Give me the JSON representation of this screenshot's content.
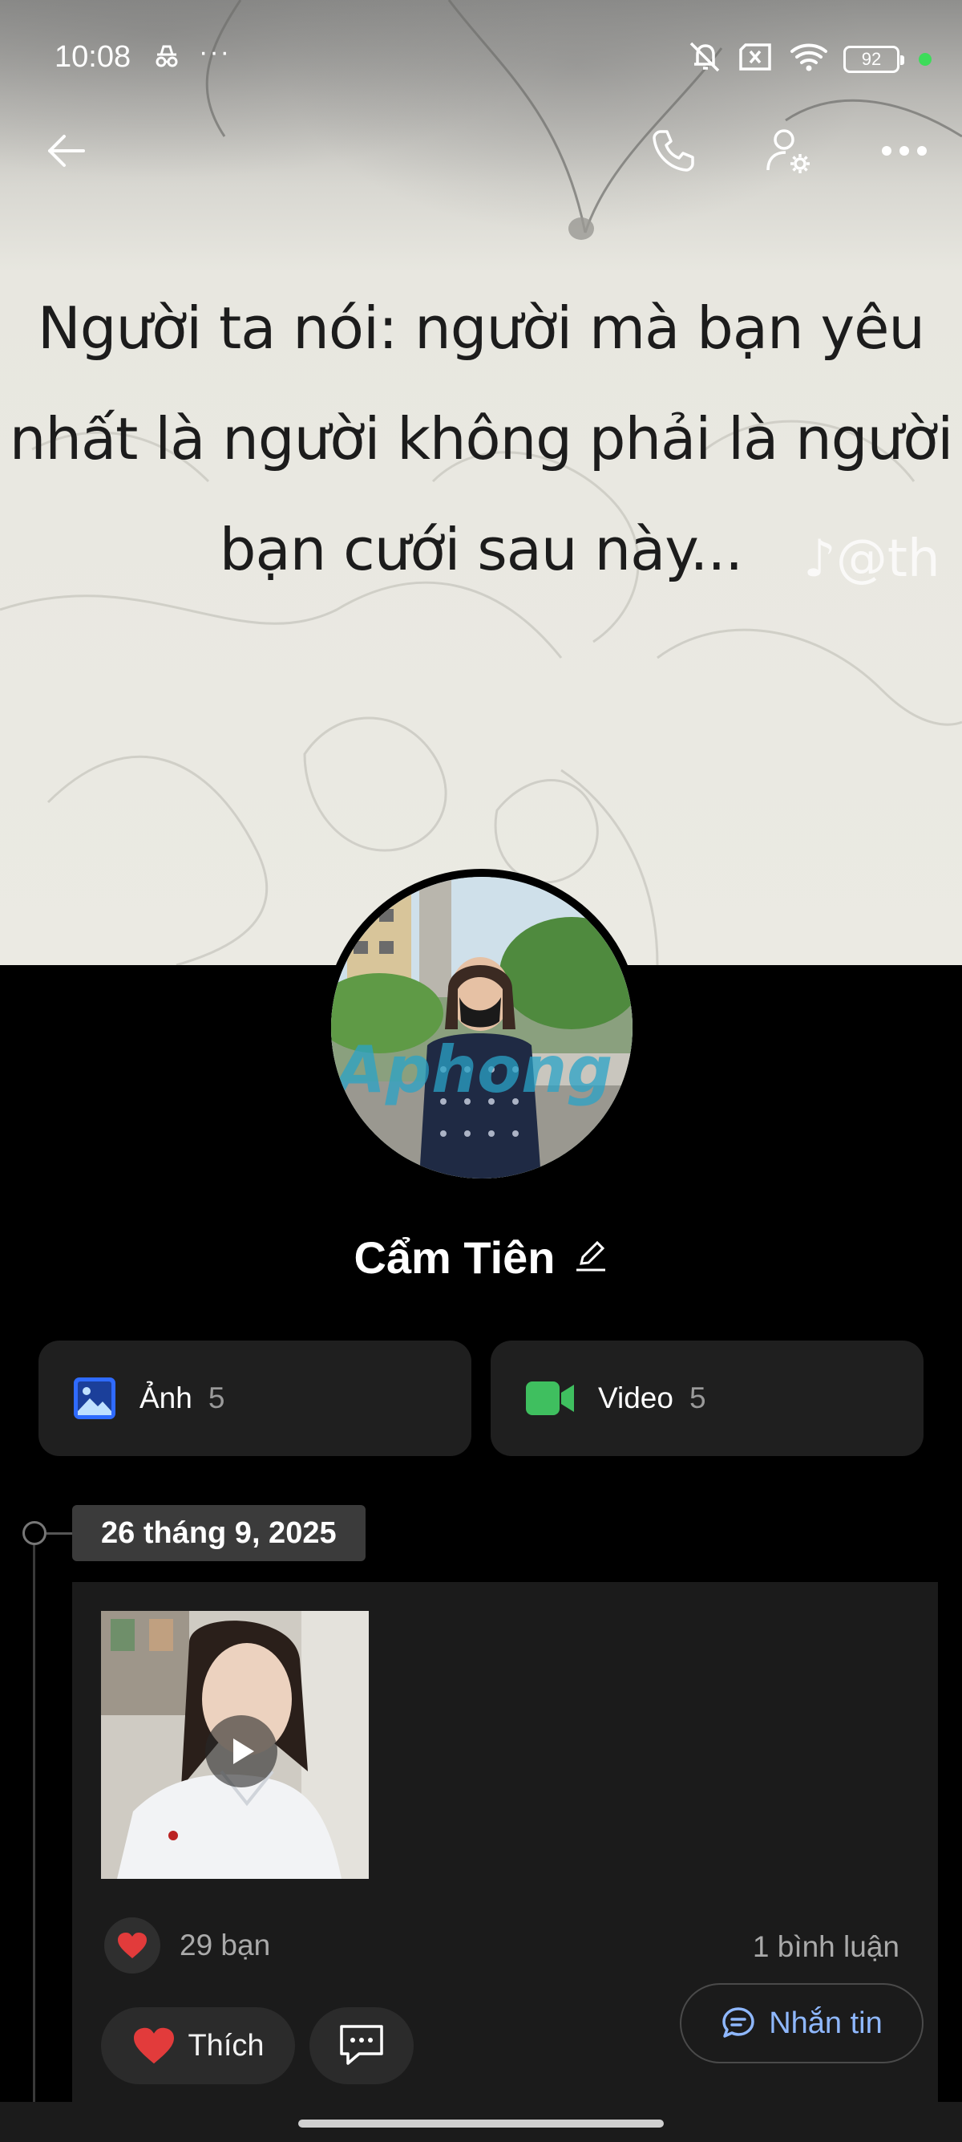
{
  "status_bar": {
    "time": "10:08",
    "battery": "92",
    "icons": [
      "incognito-icon",
      "more-dots-icon",
      "mute-icon",
      "no-sim-icon",
      "wifi-icon",
      "battery-icon"
    ]
  },
  "cover": {
    "quote_lines": [
      "Người ta nói: người mà bạn yêu",
      "nhất là người không phải là người",
      "bạn cưới sau này..."
    ],
    "watermark": "♪@th"
  },
  "header": {
    "icons": [
      "back-arrow-icon",
      "phone-icon",
      "profile-settings-icon",
      "more-horizontal-icon"
    ]
  },
  "profile": {
    "name": "Cẩm Tiên",
    "avatar_watermark": "Aphong"
  },
  "media": {
    "photos": {
      "label": "Ảnh",
      "count": "5"
    },
    "videos": {
      "label": "Video",
      "count": "5"
    }
  },
  "timeline": {
    "date": "26 tháng 9, 2025",
    "post": {
      "reaction_count": "29 bạn",
      "comment_count": "1 bình luận",
      "like_label": "Thích",
      "message_label": "Nhắn tin"
    }
  },
  "colors": {
    "background": "#000000",
    "card": "#1f1f1f",
    "accent_blue": "#8fb8ff",
    "photo_icon": "#2f6bff",
    "video_icon": "#3fbf5f",
    "heart": "#e23b3b"
  }
}
